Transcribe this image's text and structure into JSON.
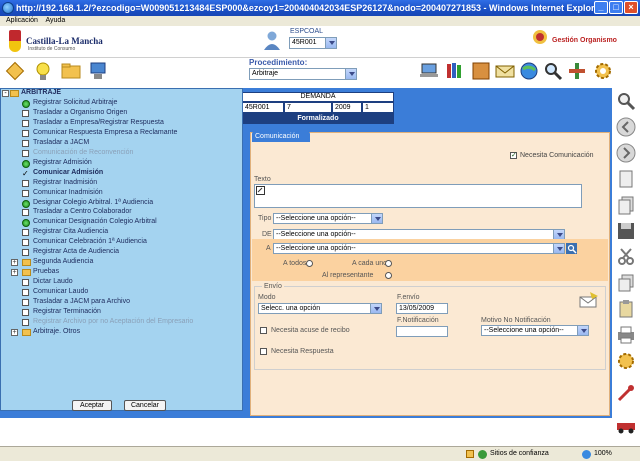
{
  "window": {
    "title": "http://192.168.1.2/?ezcodigo=W009051213484ESP000&ezcoy1=200404042034ESP26127&nodo=200407271853 - Windows Internet Explorer"
  },
  "menubar": {
    "items": [
      "Aplicación",
      "Ayuda"
    ]
  },
  "header": {
    "logo_title": "Castilla-La Mancha",
    "logo_subtitle": "Instituto de Consumo",
    "espcoal_label": "ESPCOAL",
    "espcoal_value": "45R001",
    "gestion_label": "Gestión Organismo"
  },
  "procedimiento": {
    "label": "Procedimiento:",
    "value": "Arbitraje"
  },
  "demanda": {
    "title": "DEMANDA",
    "cells": [
      "45R001",
      "7",
      "2009",
      "1"
    ],
    "status": "Formalizado"
  },
  "tree": {
    "root": "ARBITRAJE",
    "items": [
      {
        "label": "Registrar Solicitud Arbitraje",
        "icon": "done"
      },
      {
        "label": "Trasladar a Organismo Origen",
        "icon": "box"
      },
      {
        "label": "Trasladar a Empresa/Registrar Respuesta",
        "icon": "box"
      },
      {
        "label": "Comunicar Respuesta Empresa a Reclamante",
        "icon": "box"
      },
      {
        "label": "Trasladar a JACM",
        "icon": "box"
      },
      {
        "label": "Comunicación de Reconvención",
        "icon": "box",
        "disabled": true
      },
      {
        "label": "Registrar Admisión",
        "icon": "done"
      },
      {
        "label": "Comunicar Admisión",
        "icon": "check",
        "bold": true
      },
      {
        "label": "Registrar Inadmisión",
        "icon": "box"
      },
      {
        "label": "Comunicar Inadmisión",
        "icon": "box"
      },
      {
        "label": "Designar Colegio Arbitral. 1ª Audiencia",
        "icon": "done"
      },
      {
        "label": "Trasladar a Centro Colaborador",
        "icon": "box"
      },
      {
        "label": "Comunicar Designación Colegio Arbitral",
        "icon": "done"
      },
      {
        "label": "Registrar Cita Audiencia",
        "icon": "box"
      },
      {
        "label": "Comunicar Celebración 1ª Audiencia",
        "icon": "box"
      },
      {
        "label": "Registrar Acta de Audiencia",
        "icon": "box"
      },
      {
        "label": "Segunda Audiencia",
        "icon": "folder"
      },
      {
        "label": "Pruebas",
        "icon": "folder"
      },
      {
        "label": "Dictar Laudo",
        "icon": "box"
      },
      {
        "label": "Comunicar Laudo",
        "icon": "box"
      },
      {
        "label": "Trasladar a JACM para Archivo",
        "icon": "box"
      },
      {
        "label": "Registrar Terminación",
        "icon": "box"
      },
      {
        "label": "Registrar Archivo por no Aceptación del Empresario",
        "icon": "box",
        "disabled": true
      },
      {
        "label": "Arbitraje. Otros",
        "icon": "folder"
      }
    ],
    "accept_label": "Aceptar",
    "cancel_label": "Cancelar"
  },
  "form": {
    "tab_label": "Comunicación",
    "necesita_comunicacion": "Necesita Comunicación",
    "texto_label": "Texto",
    "tipo_label": "Tipo",
    "tipo_value": "--Seleccione una opción--",
    "de_label": "DE",
    "de_value": "--Seleccione una opción--",
    "a_label": "A",
    "a_value": "--Seleccione una opción--",
    "a_todos": "A todos",
    "a_cada_uno": "A cada uno",
    "al_representante": "Al representante",
    "envio_legend": "Envío",
    "modo_label": "Modo",
    "modo_value": "Selecc. una opción",
    "fenvio_label": "F.envío",
    "fenvio_value": "13/05/2009",
    "fnotificacion_label": "F.Notificación",
    "acuse_label": "Necesita acuse de recibo",
    "motivo_label": "Motivo No Notificación",
    "motivo_value": "--Seleccione una opción--",
    "respuesta_label": "Necesita Respuesta"
  },
  "status": {
    "zone": "Sitios de confianza",
    "zoom": "100%"
  },
  "colors": {
    "panel_blue": "#3b7dd8",
    "tree_bg": "#a4d3f0",
    "form_bg": "#fbe9d3"
  }
}
